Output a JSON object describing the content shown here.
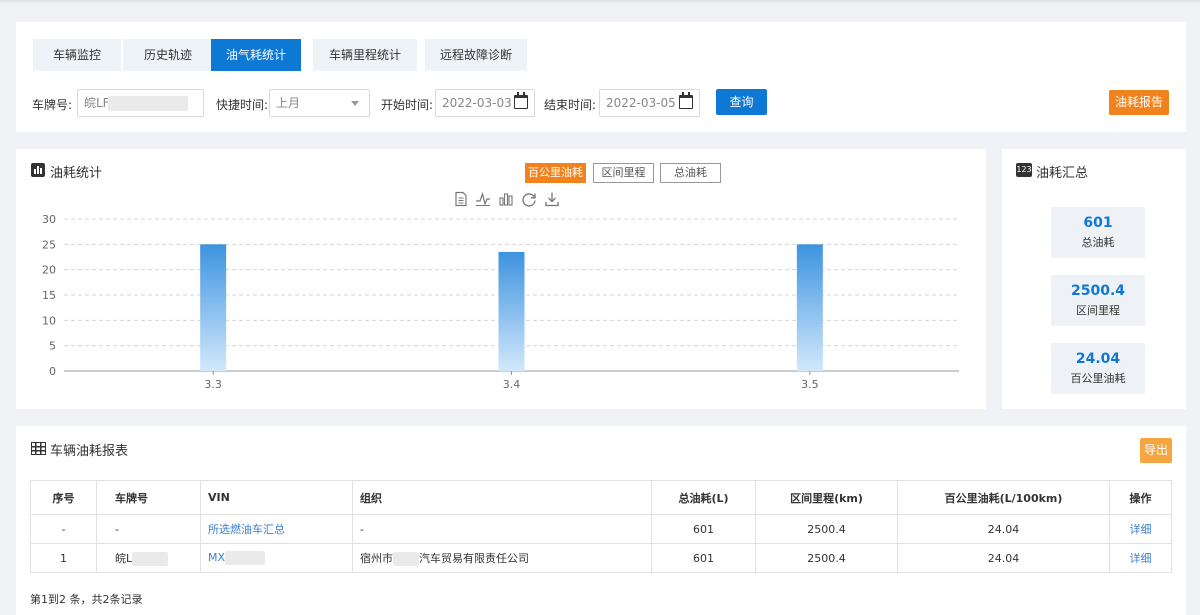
{
  "tabs": [
    "车辆监控",
    "历史轨迹",
    "油气耗统计",
    "车辆里程统计",
    "远程故障诊断"
  ],
  "active_tab": 2,
  "filters": {
    "plate_label": "车牌号:",
    "plate_value": "皖LF",
    "quick_label": "快捷时间:",
    "quick_value": "上月",
    "start_label": "开始时间:",
    "start_value": "2022-03-03",
    "end_label": "结束时间:",
    "end_value": "2022-03-05",
    "query_button": "查询",
    "report_button": "油耗报告"
  },
  "chart_panel": {
    "title": "油耗统计",
    "legend_buttons": [
      "百公里油耗",
      "区间里程",
      "总油耗"
    ],
    "active_legend": 0,
    "toolbox_icons": [
      "data-view-icon",
      "line-chart-icon",
      "bar-chart-icon",
      "refresh-icon",
      "download-icon"
    ]
  },
  "chart_data": {
    "type": "bar",
    "categories": [
      "3.3",
      "3.4",
      "3.5"
    ],
    "values": [
      25,
      23.5,
      25
    ],
    "ylim": [
      0,
      30
    ],
    "yticks": [
      0,
      5,
      10,
      15,
      20,
      25,
      30
    ],
    "grid": true,
    "bar_color": "#3d93e0",
    "bar_color_light": "#d2e8fb"
  },
  "summary": {
    "title": "油耗汇总",
    "icon_text": "123",
    "cards": [
      {
        "value": "601",
        "label": "总油耗"
      },
      {
        "value": "2500.4",
        "label": "区间里程"
      },
      {
        "value": "24.04",
        "label": "百公里油耗"
      }
    ]
  },
  "table_panel": {
    "title": "车辆油耗报表",
    "export_button": "导出",
    "headers": [
      "序号",
      "车牌号",
      "VIN",
      "组织",
      "总油耗(L)",
      "区间里程(km)",
      "百公里油耗(L/100km)",
      "操作"
    ],
    "rows": [
      {
        "idx": "-",
        "plate": "-",
        "vin": "所选燃油车汇总",
        "org": "-",
        "fuel": "601",
        "mileage": "2500.4",
        "per100": "24.04",
        "op": "详细"
      },
      {
        "idx": "1",
        "plate": "皖L",
        "vin": "MX",
        "org": "宿州市",
        "org_suffix": "汽车贸易有限责任公司",
        "fuel": "601",
        "mileage": "2500.4",
        "per100": "24.04",
        "op": "详细"
      }
    ],
    "footer": "第1到2 条，共2条记录"
  },
  "colors": {
    "primary": "#0e78d5",
    "accent": "#f0831e",
    "link": "#3a7ed4"
  }
}
